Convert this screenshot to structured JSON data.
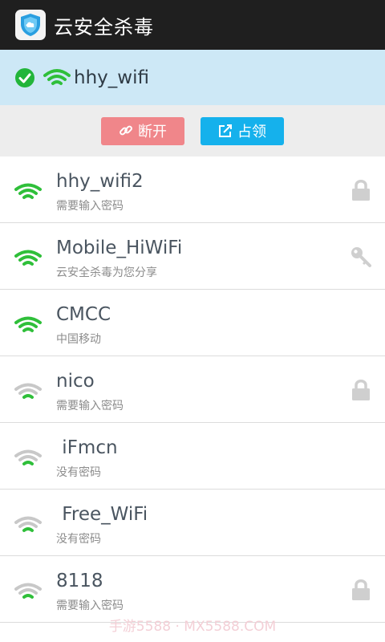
{
  "app": {
    "title": "云安全杀毒",
    "icon": "shield-icon"
  },
  "connected": {
    "ssid": "hhy_wifi",
    "status_icon": "check-circle-icon"
  },
  "actions": {
    "disconnect_label": "断开",
    "occupy_label": "占领"
  },
  "networks": [
    {
      "name": "hhy_wifi2",
      "subtitle": "需要输入密码",
      "signal": "strong",
      "right_icon": "lock-icon"
    },
    {
      "name": "Mobile_HiWiFi",
      "subtitle": "云安全杀毒为您分享",
      "signal": "strong",
      "right_icon": "key-icon"
    },
    {
      "name": "CMCC",
      "subtitle": "中国移动",
      "signal": "strong",
      "right_icon": ""
    },
    {
      "name": "nico",
      "subtitle": "需要输入密码",
      "signal": "weak",
      "right_icon": "lock-icon"
    },
    {
      "name": " iFmcn",
      "subtitle": "没有密码",
      "signal": "weak",
      "right_icon": ""
    },
    {
      "name": " Free_WiFi",
      "subtitle": "没有密码",
      "signal": "weak",
      "right_icon": ""
    },
    {
      "name": "8118",
      "subtitle": "需要输入密码",
      "signal": "weak",
      "right_icon": "lock-icon"
    }
  ],
  "watermark": "手游5588 · MX5588.COM",
  "colors": {
    "titlebar": "#1f1f1f",
    "connected_bg": "#cde8f6",
    "wifi_green": "#2fbf3a",
    "wifi_gray": "#c8c8c8",
    "disconnect": "#f0868a",
    "occupy": "#15b1ec"
  }
}
